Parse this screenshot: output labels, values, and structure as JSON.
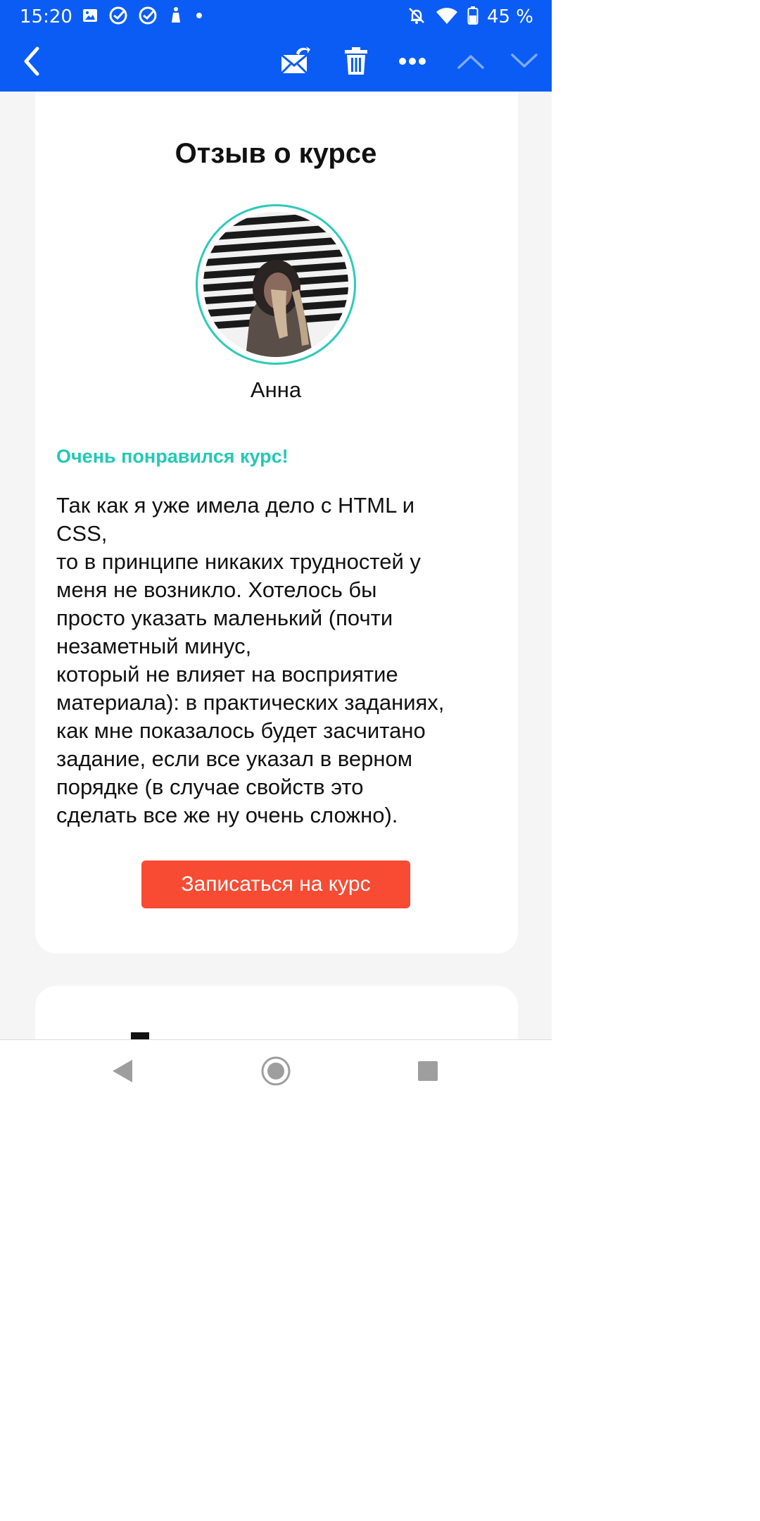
{
  "status_bar": {
    "time": "15:20",
    "left_icons": [
      "image-icon",
      "check-circle-icon",
      "check-circle-icon",
      "pointer-icon",
      "dot-icon"
    ],
    "right_icons": [
      "bell-off-icon",
      "wifi-icon",
      "battery-icon"
    ],
    "battery": "45 %"
  },
  "app_bar": {
    "actions": [
      "back-icon",
      "mark-unread-icon",
      "trash-icon",
      "more-icon",
      "previous-icon",
      "next-icon"
    ]
  },
  "review_card": {
    "title": "Отзыв о курсе",
    "reviewer_name": "Анна",
    "headline": "Очень понравился курс!",
    "body": "Так как я уже имела дело с HTML и\nCSS,\nто в принципе никаких трудностей у\nменя не возникло. Хотелось бы\nпросто указать маленький (почти\nнезаметный минус,\nкоторый не влияет на восприятие\nматериала): в практических заданиях,\nкак мне показалось будет засчитано\nзадание, если все указал в верном\nпорядке (в случае свойств это\nсделать все же ну очень сложно).",
    "button_label": "Записаться на курс"
  },
  "nav_bar": {
    "buttons": [
      "nav-back-icon",
      "nav-home-icon",
      "nav-recents-icon"
    ]
  },
  "colors": {
    "header": "#0a5cf5",
    "accent_teal": "#22c9b6",
    "cta": "#f74b33"
  }
}
